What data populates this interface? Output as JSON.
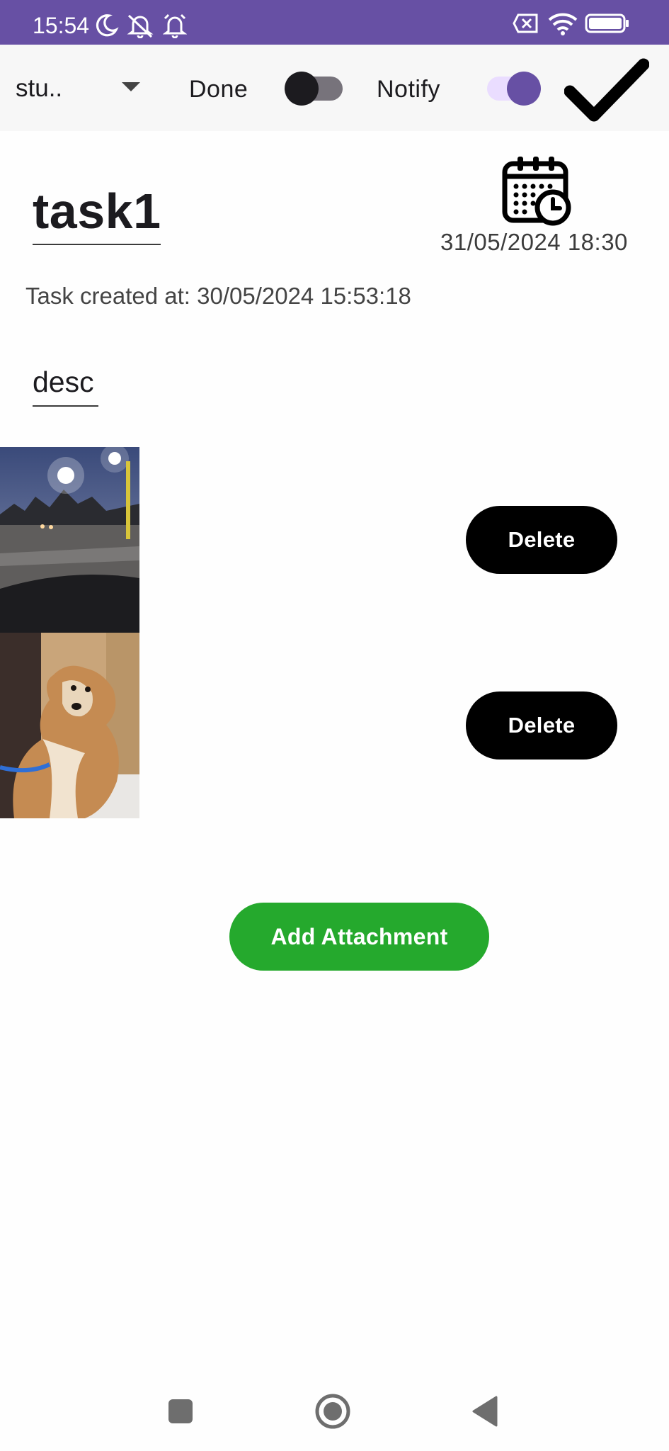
{
  "status_bar": {
    "time": "15:54",
    "icons": [
      "moon-icon",
      "notifications-off-icon",
      "alarm-icon",
      "no-sim-icon",
      "wifi-icon",
      "battery-icon"
    ]
  },
  "toolbar": {
    "category_value": "stu..",
    "done_label": "Done",
    "done_checked": false,
    "notify_label": "Notify",
    "notify_checked": true,
    "save_icon": "checkmark-icon"
  },
  "task": {
    "title": "task1",
    "due_date": "31/05/2024 18:30",
    "created_at": "Task created at: 30/05/2024 15:53:18",
    "description": "desc"
  },
  "attachments": [
    {
      "image": "night-road-photo",
      "delete_label": "Delete"
    },
    {
      "image": "dog-photo",
      "delete_label": "Delete"
    }
  ],
  "add_attachment_label": "Add Attachment",
  "colors": {
    "accent": "#6750a4",
    "add_button": "#25a92d",
    "delete_button": "#000000"
  },
  "nav_bar": [
    "recents-icon",
    "home-icon",
    "back-icon"
  ]
}
